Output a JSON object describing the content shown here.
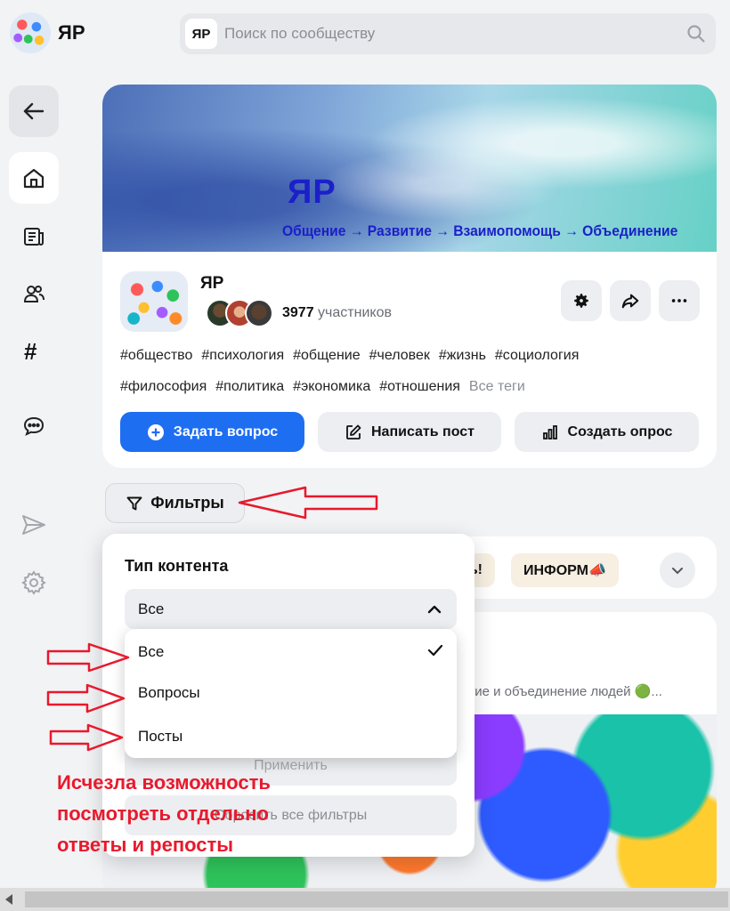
{
  "header": {
    "logo_text": "ЯР",
    "search_badge": "ЯР",
    "search_placeholder": "Поиск по сообществу"
  },
  "banner": {
    "title": "ЯР",
    "subtitle": "Общение → Развитие → Взаимопомощь → Объединение"
  },
  "community": {
    "name": "ЯР",
    "member_count": "3977",
    "member_label": "участников",
    "tags_row1": [
      "#общество",
      "#психология",
      "#общение",
      "#человек",
      "#жизнь",
      "#социология"
    ],
    "tags_row2": [
      "#философия",
      "#политика",
      "#экономика",
      "#отношения"
    ],
    "all_tags_label": "Все теги"
  },
  "actions": {
    "ask_label": "Задать вопрос",
    "post_label": "Написать пост",
    "poll_label": "Создать опрос"
  },
  "filters": {
    "button_label": "Фильтры",
    "content_type_title": "Тип контента",
    "selected_value": "Все",
    "options": [
      "Все",
      "Вопросы",
      "Посты"
    ],
    "apply_label": "Применить",
    "reset_label": "Сбросить все фильтры"
  },
  "chips": {
    "partial_chip": "ть!",
    "inform_chip": "ИНФОРМ📣"
  },
  "post": {
    "desc": "витие и объединение людей 🟢..."
  },
  "annotation": {
    "line1": "Исчезла возможность",
    "line2": "посмотреть отдельно",
    "line3": "ответы и репосты"
  },
  "colors": {
    "accent": "#1e6ef2",
    "annotation_red": "#e8192c",
    "banner_text": "#1b20c8"
  }
}
